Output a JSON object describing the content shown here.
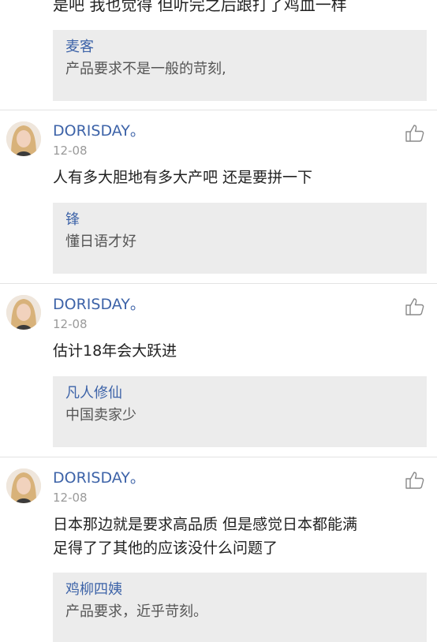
{
  "top_comment": {
    "text": "是吧 我也觉得 但听完之后跟打了鸡血一样",
    "quote": {
      "name": "麦客",
      "text": "产品要求不是一般的苛刻,"
    }
  },
  "comments": [
    {
      "user": "DORISDAY。",
      "date": "12-08",
      "lines": [
        "人有多大胆地有多大产吧 还是要拼一下"
      ],
      "quote": {
        "name": "锋",
        "text": "懂日语才好"
      }
    },
    {
      "user": "DORISDAY。",
      "date": "12-08",
      "lines": [
        "估计18年会大跃进"
      ],
      "quote": {
        "name": "凡人修仙",
        "text": "中国卖家少"
      }
    },
    {
      "user": "DORISDAY。",
      "date": "12-08",
      "lines": [
        "日本那边就是要求高品质 但是感觉日本都能满",
        "足得了了其他的应该没什么问题了"
      ],
      "quote": {
        "name": "鸡柳四姨",
        "text": "产品要求，近乎苛刻。"
      }
    }
  ],
  "icons": {
    "like": "thumbs-up-icon",
    "avatar": "user-avatar"
  },
  "colors": {
    "username": "#3d63a8",
    "quote_bg": "#ececec",
    "date": "#9a9a9a"
  }
}
